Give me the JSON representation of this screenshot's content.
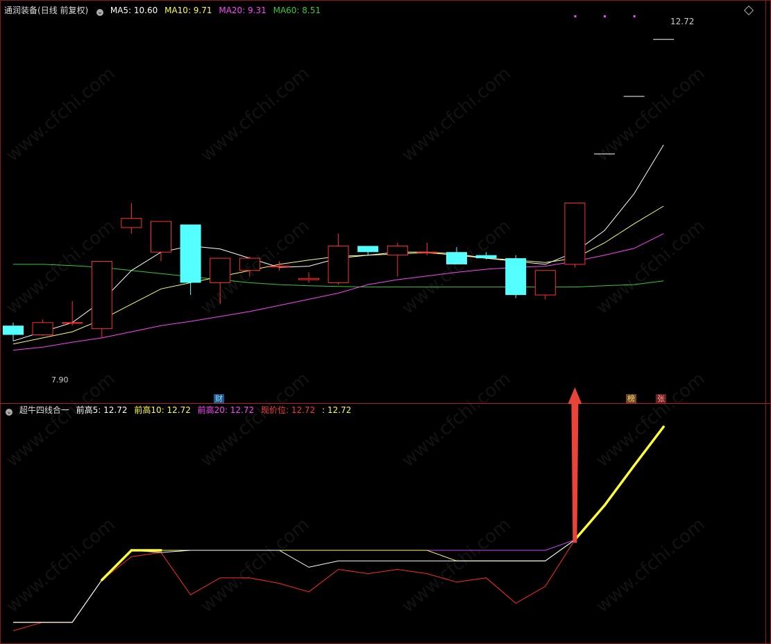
{
  "stock_name": "通润装备",
  "period": "(日线 前复权)",
  "upper_legend": [
    {
      "label": "MA5: 10.60",
      "color": "#ffffff"
    },
    {
      "label": "MA10: 9.71",
      "color": "#ffff44"
    },
    {
      "label": "MA20: 9.31",
      "color": "#ff44ff"
    },
    {
      "label": "MA60: 8.51",
      "color": "#33cc33"
    }
  ],
  "indicator_name": "超牛四线合一",
  "lower_legend": [
    {
      "label": "前高5: 12.72",
      "color": "#ffffff"
    },
    {
      "label": "前高10: 12.72",
      "color": "#ffff44"
    },
    {
      "label": "前高20: 12.72",
      "color": "#ff44ff"
    },
    {
      "label": "现价位: 12.72",
      "color": "#ff3333"
    },
    {
      "label": ": 12.72",
      "color": "#ffff44"
    }
  ],
  "high_marker": "12.72",
  "low_marker": "7.90",
  "event_badges": [
    {
      "text": "财",
      "bg": "#1a5a8a",
      "color": "#9fd9ff",
      "index": 7
    },
    {
      "text": "榜",
      "bg": "#6b4a1f",
      "color": "#ffd27f",
      "index": 21
    },
    {
      "text": "张",
      "bg": "#6b1f1f",
      "color": "#ff9f9f",
      "index": 22
    }
  ],
  "watermark": "www.cfchi.com",
  "chart_data": {
    "type": "candlestick",
    "price_range": [
      7.0,
      13.0
    ],
    "candles": [
      {
        "o": 8.05,
        "c": 7.9,
        "h": 8.1,
        "l": 7.8
      },
      {
        "o": 7.9,
        "c": 8.1,
        "h": 8.15,
        "l": 7.88
      },
      {
        "o": 8.1,
        "c": 8.1,
        "h": 8.45,
        "l": 8.05
      },
      {
        "o": 8.0,
        "c": 9.1,
        "h": 9.1,
        "l": 7.85
      },
      {
        "o": 9.65,
        "c": 9.8,
        "h": 10.05,
        "l": 9.55
      },
      {
        "o": 9.25,
        "c": 9.75,
        "h": 9.75,
        "l": 9.1
      },
      {
        "o": 9.7,
        "c": 8.75,
        "h": 9.7,
        "l": 8.55
      },
      {
        "o": 8.75,
        "c": 9.15,
        "h": 9.15,
        "l": 8.4
      },
      {
        "o": 8.95,
        "c": 9.15,
        "h": 9.18,
        "l": 8.85
      },
      {
        "o": 9.02,
        "c": 9.02,
        "h": 9.1,
        "l": 8.95
      },
      {
        "o": 8.8,
        "c": 8.82,
        "h": 8.92,
        "l": 8.75
      },
      {
        "o": 8.75,
        "c": 9.35,
        "h": 9.55,
        "l": 8.72
      },
      {
        "o": 9.35,
        "c": 9.25,
        "h": 9.35,
        "l": 9.2
      },
      {
        "o": 9.2,
        "c": 9.35,
        "h": 9.4,
        "l": 8.85
      },
      {
        "o": 9.25,
        "c": 9.25,
        "h": 9.4,
        "l": 9.2
      },
      {
        "o": 9.25,
        "c": 9.05,
        "h": 9.33,
        "l": 9.05
      },
      {
        "o": 9.2,
        "c": 9.15,
        "h": 9.25,
        "l": 9.13
      },
      {
        "o": 9.15,
        "c": 8.55,
        "h": 9.2,
        "l": 8.5
      },
      {
        "o": 8.55,
        "c": 8.95,
        "h": 8.95,
        "l": 8.48
      },
      {
        "o": 9.05,
        "c": 10.05,
        "h": 10.05,
        "l": 9.0
      },
      {
        "o": 10.85,
        "c": 10.85,
        "h": 10.86,
        "l": 10.84
      },
      {
        "o": 11.79,
        "c": 11.79,
        "h": 11.8,
        "l": 11.78
      },
      {
        "o": 12.72,
        "c": 12.72,
        "h": 12.73,
        "l": 12.71
      }
    ],
    "ma5": [
      7.8,
      7.95,
      8.1,
      8.45,
      8.95,
      9.25,
      9.35,
      9.3,
      9.15,
      9.0,
      9.02,
      9.15,
      9.2,
      9.25,
      9.25,
      9.22,
      9.15,
      9.1,
      9.05,
      9.25,
      9.6,
      10.2,
      11.0
    ],
    "ma10": [
      7.75,
      7.85,
      7.95,
      8.15,
      8.4,
      8.65,
      8.75,
      8.85,
      8.95,
      9.05,
      9.12,
      9.18,
      9.2,
      9.22,
      9.24,
      9.2,
      9.15,
      9.12,
      9.08,
      9.15,
      9.4,
      9.71,
      10.0
    ],
    "ma20": [
      7.65,
      7.7,
      7.78,
      7.85,
      7.95,
      8.05,
      8.12,
      8.2,
      8.28,
      8.38,
      8.48,
      8.58,
      8.72,
      8.8,
      8.86,
      8.92,
      8.97,
      9.0,
      9.02,
      9.1,
      9.2,
      9.31,
      9.55
    ],
    "ma60": [
      9.05,
      9.05,
      9.03,
      9.0,
      8.95,
      8.9,
      8.85,
      8.8,
      8.75,
      8.72,
      8.7,
      8.69,
      8.68,
      8.68,
      8.68,
      8.68,
      8.68,
      8.68,
      8.68,
      8.68,
      8.7,
      8.72,
      8.78
    ],
    "lower": {
      "range": [
        7.8,
        12.9
      ],
      "front_high5": [
        8.1,
        8.1,
        8.1,
        9.1,
        9.8,
        9.75,
        9.8,
        9.8,
        9.8,
        9.8,
        9.4,
        9.55,
        9.55,
        9.55,
        9.55,
        9.55,
        9.55,
        9.55,
        9.55,
        10.05,
        10.86,
        11.8,
        12.72
      ],
      "front_high10": [
        8.1,
        8.1,
        8.1,
        9.1,
        9.8,
        9.8,
        9.8,
        9.8,
        9.8,
        9.8,
        9.8,
        9.8,
        9.8,
        9.8,
        9.8,
        9.55,
        9.55,
        9.55,
        9.55,
        10.05,
        10.86,
        11.8,
        12.72
      ],
      "front_high20": [
        8.1,
        8.1,
        8.1,
        9.1,
        9.8,
        9.8,
        9.8,
        9.8,
        9.8,
        9.8,
        9.8,
        9.8,
        9.8,
        9.8,
        9.8,
        9.8,
        9.8,
        9.8,
        9.8,
        10.05,
        10.86,
        11.8,
        12.72
      ],
      "current": [
        7.9,
        8.1,
        8.1,
        9.1,
        9.65,
        9.75,
        8.75,
        9.15,
        9.15,
        9.02,
        8.82,
        9.35,
        9.25,
        9.35,
        9.25,
        9.05,
        9.15,
        8.55,
        8.95,
        10.05,
        10.86,
        11.8,
        12.72
      ],
      "yellow_points": [
        3,
        4,
        5,
        19,
        20,
        21,
        22
      ]
    }
  }
}
